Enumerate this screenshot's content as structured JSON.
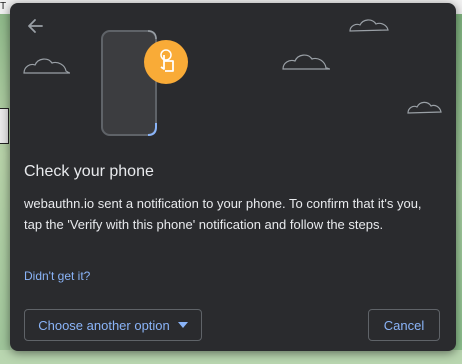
{
  "background": {
    "top_fragment": "T"
  },
  "dialog": {
    "title": "Check your phone",
    "description": "webauthn.io sent a notification to your phone. To confirm that it's you, tap the 'Verify with this phone' notification and follow the steps.",
    "help_link": "Didn't get it?",
    "choose_option_label": "Choose another option",
    "cancel_label": "Cancel"
  },
  "icons": {
    "back": "arrow-left-icon",
    "phone": "phone-icon",
    "tap": "finger-tap-icon",
    "clouds": "cloud-icon",
    "dropdown": "caret-down-icon"
  },
  "colors": {
    "dialog_bg": "#2a2b2e",
    "text": "#e8eaed",
    "accent": "#8ab4f8",
    "tap_badge": "#f9ab37",
    "border": "#5f6368"
  }
}
